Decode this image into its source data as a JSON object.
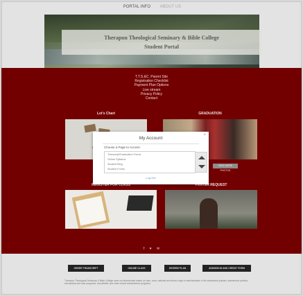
{
  "topnav": {
    "item1": "PORTAL INFO",
    "item2": "ABOUT US"
  },
  "hero": {
    "title_line1": "Therapon Theological Seminary & Bible College",
    "title_line2": "Student Portal"
  },
  "links": [
    "T.T.S.&C. Parent Site",
    "Registration Checklist",
    "Payment Plan Options",
    "Live stream",
    "Privacy Policy",
    "Contact"
  ],
  "sections": {
    "chart": "Let's Chart",
    "graduation": "GRADUATION",
    "register": "REGISTER FOR CLASS",
    "prayer": "PRAYER REQUEST",
    "more_button": "VIEW MORE PHOTOS"
  },
  "social": {
    "icon1": "f",
    "icon2": "♥",
    "icon3": "✉"
  },
  "modal": {
    "title": "My Account",
    "close": "×",
    "prompt": "Choose a Page to Access:",
    "options": [
      "Transcript/Graduation Forms",
      "Online Syllabus",
      "Student Blog",
      "Student Forms"
    ],
    "login": "Log Out"
  },
  "footer": {
    "buttons": [
      "ORDER TRANSCRIPT",
      "ONLINE CLASS",
      "DEGREE PLAN",
      "ADMISSION AND CREDIT FORM"
    ],
    "text": "Therapon Theological Seminary & Bible College does not discriminate based on race, color, national and ethnic origin in administration of its educational policies, admissions policies, scholarship and loan programs, and athletic and other school-administered programs."
  },
  "colors": {
    "maroon": "#730000",
    "page_bg": "#e3e3e3",
    "link_blue": "#6b8fc8"
  }
}
